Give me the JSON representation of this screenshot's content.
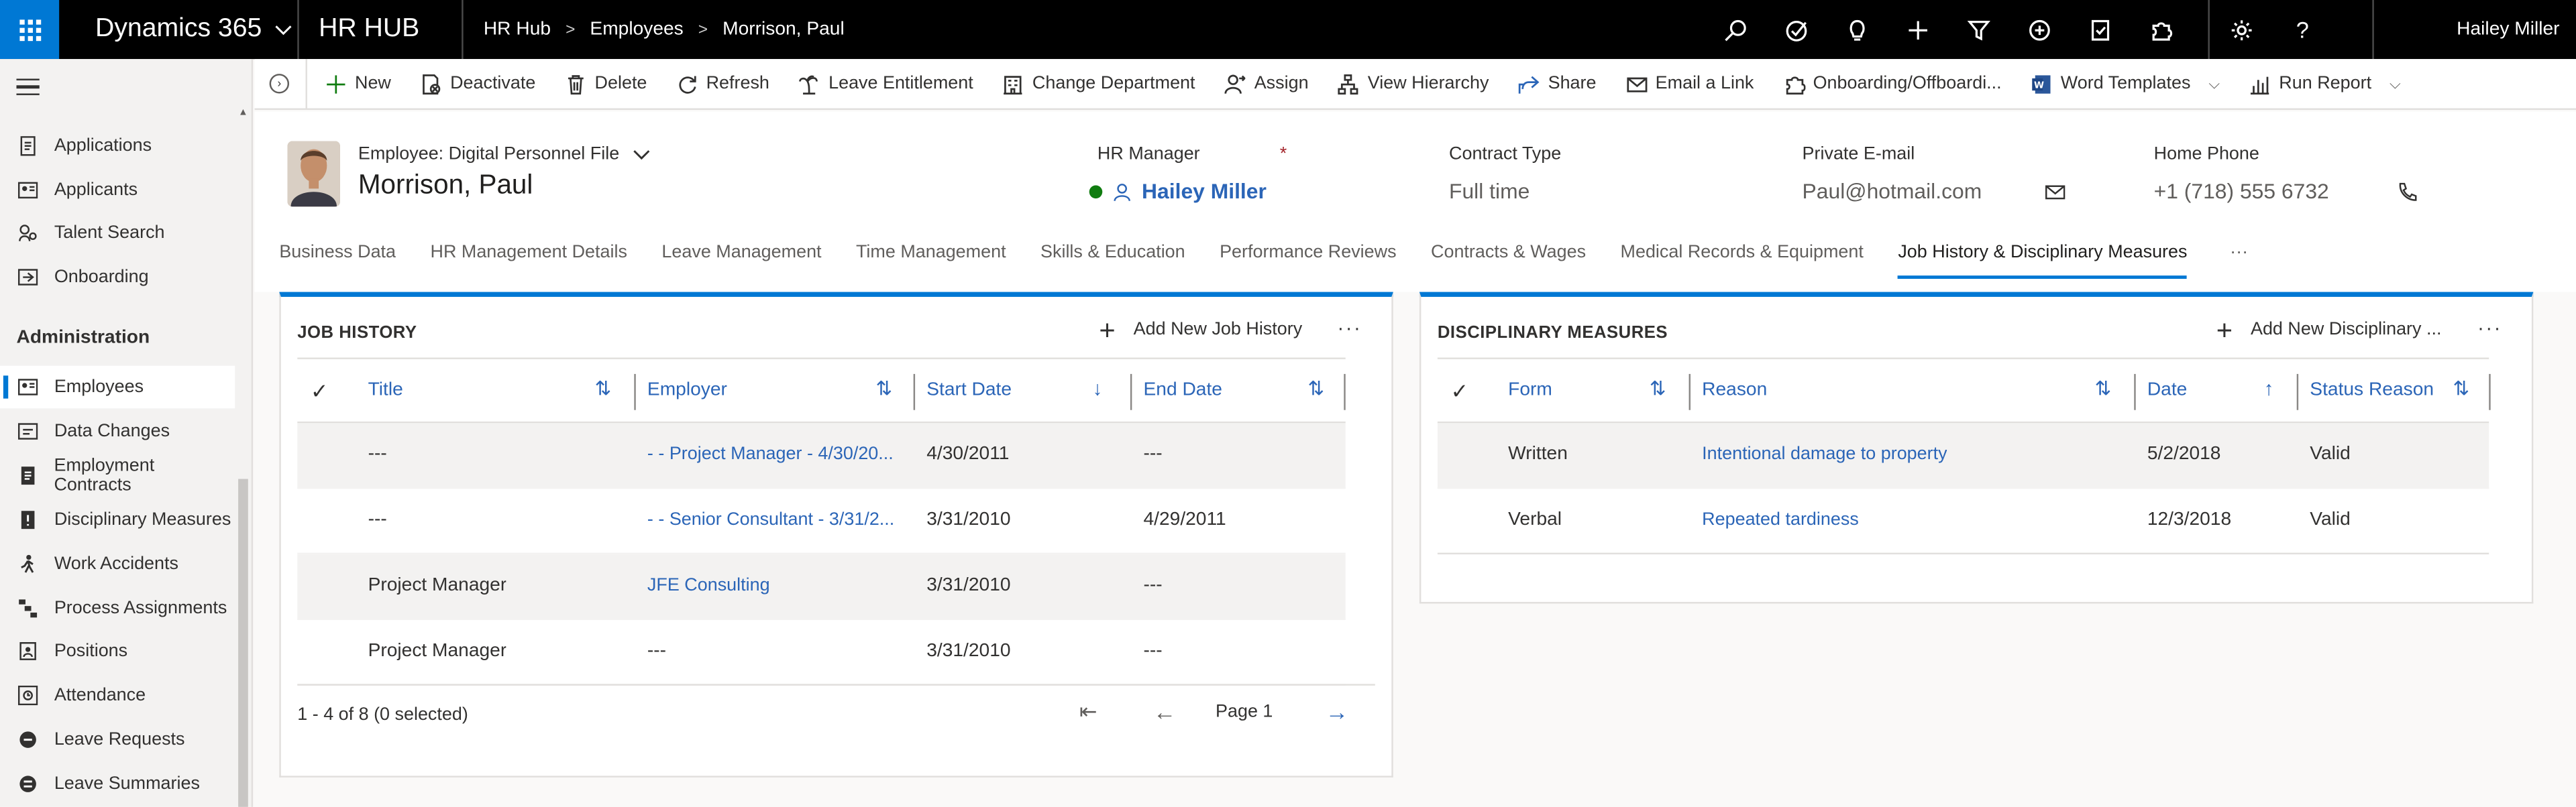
{
  "topbar": {
    "app_name": "Dynamics 365",
    "hub_name": "HR HUB",
    "breadcrumb": [
      "HR Hub",
      "Employees",
      "Morrison, Paul"
    ],
    "user": "Hailey Miller"
  },
  "sidebar": {
    "items_top": [
      {
        "label": "Applications",
        "icon": "document-icon"
      },
      {
        "label": "Applicants",
        "icon": "contact-card-icon"
      },
      {
        "label": "Talent Search",
        "icon": "people-search-icon"
      },
      {
        "label": "Onboarding",
        "icon": "onboarding-icon"
      }
    ],
    "section": "Administration",
    "items": [
      {
        "label": "Employees",
        "icon": "contact-card-icon"
      },
      {
        "label": "Data Changes",
        "icon": "data-change-icon"
      },
      {
        "label": "Employment Contracts",
        "icon": "document-icon"
      },
      {
        "label": "Disciplinary Measures",
        "icon": "warning-document-icon"
      },
      {
        "label": "Work Accidents",
        "icon": "person-walking-icon"
      },
      {
        "label": "Process Assignments",
        "icon": "process-icon"
      },
      {
        "label": "Positions",
        "icon": "location-pin-icon"
      },
      {
        "label": "Attendance",
        "icon": "attendance-icon"
      },
      {
        "label": "Leave Requests",
        "icon": "leave-request-icon"
      },
      {
        "label": "Leave Summaries",
        "icon": "leave-summary-icon"
      }
    ]
  },
  "commands": {
    "new": "New",
    "deactivate": "Deactivate",
    "delete": "Delete",
    "refresh": "Refresh",
    "leave_entitlement": "Leave Entitlement",
    "change_department": "Change Department",
    "assign": "Assign",
    "view_hierarchy": "View Hierarchy",
    "share": "Share",
    "email_link": "Email a Link",
    "onboarding": "Onboarding/Offboardi...",
    "word_templates": "Word Templates",
    "run_report": "Run Report"
  },
  "header": {
    "form_selector": "Employee: Digital Personnel File",
    "record_name": "Morrison, Paul",
    "hr_manager_label": "HR Manager",
    "hr_manager_value": "Hailey Miller",
    "contract_type_label": "Contract Type",
    "contract_type_value": "Full time",
    "email_label": "Private E-mail",
    "email_value": "Paul@hotmail.com",
    "phone_label": "Home Phone",
    "phone_value": "+1 (718)  555 6732",
    "required_mark": "*"
  },
  "tabs": [
    "Business Data",
    "HR Management Details",
    "Leave Management",
    "Time Management",
    "Skills & Education",
    "Performance Reviews",
    "Contracts & Wages",
    "Medical Records & Equipment",
    "Job History & Disciplinary Measures"
  ],
  "more": "···",
  "job_history": {
    "title": "JOB HISTORY",
    "add_label": "Add New Job History",
    "columns": [
      "Title",
      "Employer",
      "Start Date",
      "End Date"
    ],
    "rows": [
      {
        "title": "---",
        "employer": "-  - Project Manager - 4/30/20...",
        "start": "4/30/2011",
        "end": "---"
      },
      {
        "title": "---",
        "employer": "-  - Senior Consultant - 3/31/2...",
        "start": "3/31/2010",
        "end": "4/29/2011"
      },
      {
        "title": "Project Manager",
        "employer": "JFE Consulting",
        "start": "3/31/2010",
        "end": "---"
      },
      {
        "title": "Project Manager",
        "employer": "---",
        "start": "3/31/2010",
        "end": "---"
      }
    ],
    "record_count": "1 - 4 of 8 (0 selected)",
    "page_label": "Page 1"
  },
  "disciplinary": {
    "title": "DISCIPLINARY MEASURES",
    "add_label": "Add New Disciplinary ...",
    "columns": [
      "Form",
      "Reason",
      "Date",
      "Status Reason"
    ],
    "rows": [
      {
        "form": "Written",
        "reason": "Intentional damage to property",
        "date": "5/2/2018",
        "status": "Valid"
      },
      {
        "form": "Verbal",
        "reason": "Repeated tardiness",
        "date": "12/3/2018",
        "status": "Valid"
      }
    ]
  },
  "colors": {
    "accent": "#0078d4",
    "link": "#2b65b7",
    "topbar": "#000000",
    "status_ok": "#107c10"
  }
}
